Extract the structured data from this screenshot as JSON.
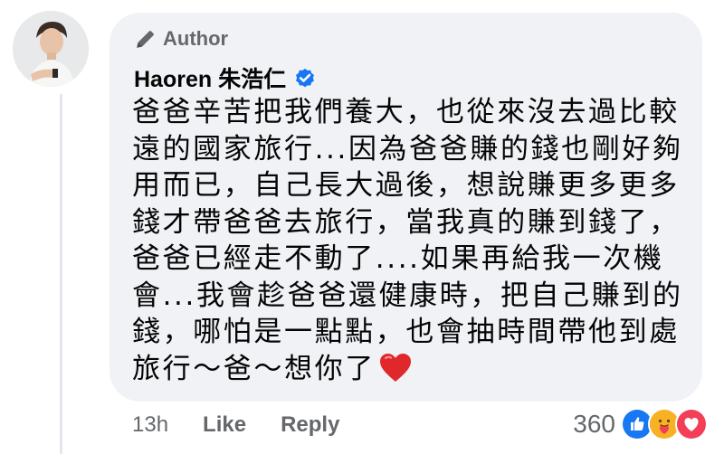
{
  "comment": {
    "author_badge": "Author",
    "author_name": "Haoren 朱浩仁",
    "body": "爸爸辛苦把我們養大，也從來沒去過比較遠的國家旅行...因為爸爸賺的錢也剛好夠用而已，自己長大過後，想說賺更多更多錢才帶爸爸去旅行，當我真的賺到錢了，爸爸已經走不動了....如果再給我一次機會...我會趁爸爸還健康時，把自己賺到的錢，哪怕是一點點，也會抽時間帶他到處旅行～爸～想你了",
    "body_emoji": "red-heart"
  },
  "actions": {
    "time": "13h",
    "like_label": "Like",
    "reply_label": "Reply"
  },
  "reactions": {
    "count": "360",
    "icons": [
      "like-reaction-icon",
      "care-reaction-icon",
      "love-reaction-icon"
    ]
  },
  "colors": {
    "bubble": "#f0f2f5",
    "secondary_text": "#65676b",
    "verified_blue": "#1877f2",
    "love_red": "#f33e58",
    "care_yellow": "#f7b125"
  }
}
